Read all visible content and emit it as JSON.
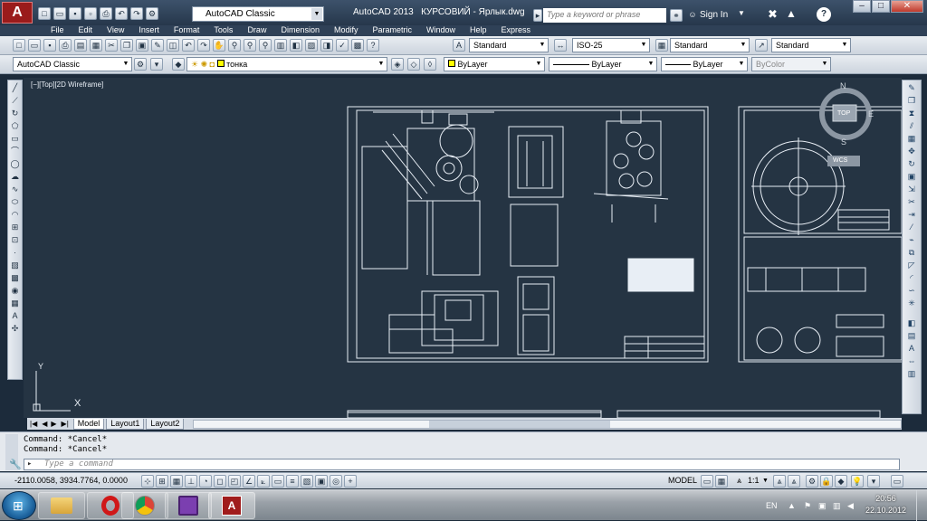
{
  "app": {
    "logo_letter": "A",
    "workspace": "AutoCAD Classic",
    "title": "AutoCAD 2013",
    "file": "КУРСОВИЙ - Ярлык.dwg",
    "search_placeholder": "Type a keyword or phrase",
    "sign_in": "Sign In",
    "help": "?"
  },
  "menu": [
    "File",
    "Edit",
    "View",
    "Insert",
    "Format",
    "Tools",
    "Draw",
    "Dimension",
    "Modify",
    "Parametric",
    "Window",
    "Help",
    "Express"
  ],
  "styles": {
    "text_style": "Standard",
    "dim_style": "ISO-25",
    "table_style": "Standard",
    "mleader_style": "Standard"
  },
  "layers": {
    "workspace": "AutoCAD Classic",
    "current_layer": "тонка",
    "color": "ByLayer",
    "linetype": "ByLayer",
    "lineweight": "ByLayer",
    "plot_style": "ByColor"
  },
  "viewport": {
    "label": "[−][Top][2D Wireframe]",
    "viewcube_top": "TOP",
    "compass_n": "N",
    "compass_s": "S",
    "compass_e": "E",
    "wcs": "WCS",
    "ucs_x": "X",
    "ucs_y": "Y"
  },
  "tabs": [
    "Model",
    "Layout1",
    "Layout2"
  ],
  "command": {
    "history": [
      "Command: *Cancel*",
      "Command: *Cancel*"
    ],
    "placeholder": "Type a command"
  },
  "status": {
    "coords": "-2110.0058, 3934.7764, 0.0000",
    "model": "MODEL",
    "scale": "1:1"
  },
  "taskbar": {
    "lang": "EN",
    "time": "20:56",
    "date": "22.10.2012"
  },
  "colors": {
    "canvas": "#253443",
    "title_bg": "#2f4157",
    "drawing_lines": "#e8eef5"
  }
}
